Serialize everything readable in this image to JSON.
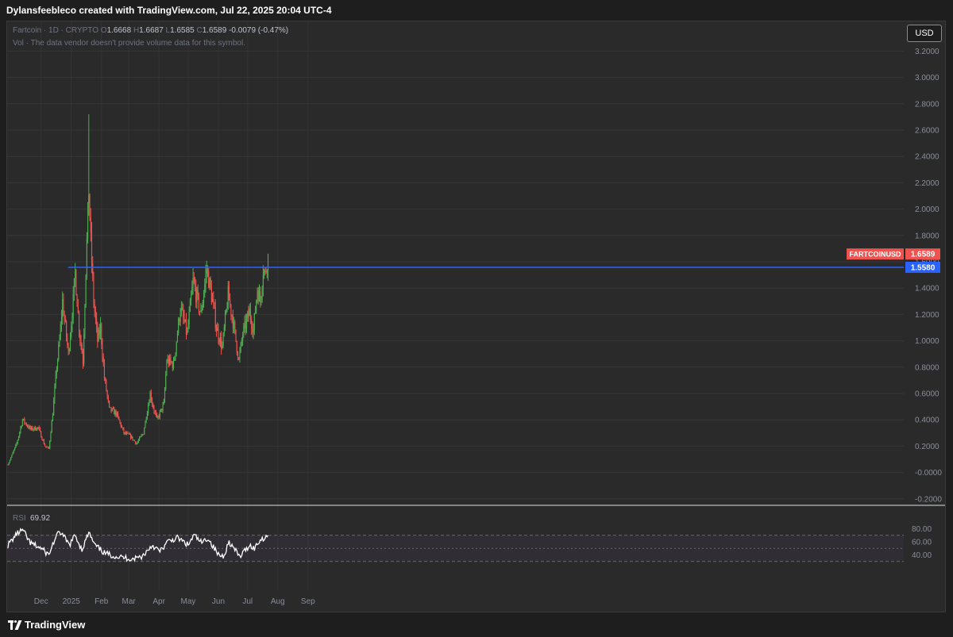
{
  "header": {
    "attribution": "Dylansfeebleco created with TradingView.com, Jul 22, 2025 20:04 UTC-4"
  },
  "legend": {
    "symbol": "Fartcoin · 1D · CRYPTO",
    "open_label": "O",
    "open": "1.6668",
    "high_label": "H",
    "high": "1.6687",
    "low_label": "L",
    "low": "1.6585",
    "close_label": "C",
    "close": "1.6589",
    "change": "-0.0079 (-0.47%)",
    "volume_note": "Vol · The data vendor doesn't provide volume data for this symbol."
  },
  "currency_button": "USD",
  "footer": {
    "brand": "TradingView"
  },
  "colors": {
    "up": "#26a69a",
    "up_bright": "#4caf50",
    "down": "#ef5350",
    "level_line": "#2962ff",
    "rsi_line": "#ffffff"
  },
  "chart_data": [
    {
      "type": "candlestick",
      "symbol_tag": "FARTCOINUSD",
      "last_price": "1.6589",
      "level_price": "1.5580",
      "horizontal_level": 1.558,
      "ylim": [
        -0.22,
        3.3
      ],
      "y_ticks": [
        "3.2000",
        "3.0000",
        "2.8000",
        "2.6000",
        "2.4000",
        "2.2000",
        "2.0000",
        "1.8000",
        "1.6000",
        "1.4000",
        "1.2000",
        "1.0000",
        "0.8000",
        "0.6000",
        "0.4000",
        "0.2000",
        "-0.0000",
        "-0.2000"
      ],
      "x_ticks": [
        "Dec",
        "2025",
        "Feb",
        "Mar",
        "Apr",
        "May",
        "Jun",
        "Jul",
        "Aug",
        "Sep"
      ],
      "anchors": [
        [
          "2024-10-28",
          0.06
        ],
        [
          "2024-11-06",
          0.22
        ],
        [
          "2024-11-12",
          0.4
        ],
        [
          "2024-11-20",
          0.33
        ],
        [
          "2024-11-28",
          0.34
        ],
        [
          "2024-12-05",
          0.2
        ],
        [
          "2024-12-09",
          0.18
        ],
        [
          "2024-12-13",
          0.45
        ],
        [
          "2024-12-17",
          0.8
        ],
        [
          "2024-12-20",
          1.0
        ],
        [
          "2024-12-23",
          1.3
        ],
        [
          "2024-12-26",
          1.1
        ],
        [
          "2024-12-29",
          0.9
        ],
        [
          "2025-01-03",
          1.3
        ],
        [
          "2025-01-05",
          1.52
        ],
        [
          "2025-01-09",
          1.1
        ],
        [
          "2025-01-13",
          0.85
        ],
        [
          "2025-01-16",
          1.55
        ],
        [
          "2025-01-19",
          2.15
        ],
        [
          "2025-01-21",
          1.75
        ],
        [
          "2025-01-24",
          1.3
        ],
        [
          "2025-01-28",
          1.0
        ],
        [
          "2025-01-31",
          1.1
        ],
        [
          "2025-02-04",
          0.72
        ],
        [
          "2025-02-09",
          0.48
        ],
        [
          "2025-02-16",
          0.45
        ],
        [
          "2025-02-24",
          0.3
        ],
        [
          "2025-03-02",
          0.28
        ],
        [
          "2025-03-09",
          0.22
        ],
        [
          "2025-03-16",
          0.3
        ],
        [
          "2025-03-23",
          0.6
        ],
        [
          "2025-03-26",
          0.5
        ],
        [
          "2025-03-30",
          0.4
        ],
        [
          "2025-04-06",
          0.52
        ],
        [
          "2025-04-09",
          0.85
        ],
        [
          "2025-04-16",
          0.82
        ],
        [
          "2025-04-23",
          1.25
        ],
        [
          "2025-04-30",
          1.05
        ],
        [
          "2025-05-06",
          1.45
        ],
        [
          "2025-05-14",
          1.2
        ],
        [
          "2025-05-20",
          1.55
        ],
        [
          "2025-05-26",
          1.3
        ],
        [
          "2025-05-30",
          1.1
        ],
        [
          "2025-06-05",
          0.95
        ],
        [
          "2025-06-11",
          1.35
        ],
        [
          "2025-06-16",
          1.15
        ],
        [
          "2025-06-22",
          0.85
        ],
        [
          "2025-06-26",
          1.05
        ],
        [
          "2025-07-03",
          1.22
        ],
        [
          "2025-07-07",
          1.08
        ],
        [
          "2025-07-11",
          1.4
        ],
        [
          "2025-07-14",
          1.3
        ],
        [
          "2025-07-17",
          1.55
        ],
        [
          "2025-07-19",
          1.5
        ],
        [
          "2025-07-22",
          1.6589
        ]
      ]
    },
    {
      "type": "line",
      "indicator": "RSI",
      "value": "69.92",
      "label": "RSI",
      "levels": [
        70,
        50,
        30
      ],
      "y_ticks": [
        "80.00",
        "60.00",
        "40.00"
      ],
      "ylim": [
        24,
        85
      ],
      "anchors": [
        [
          "2024-10-28",
          55
        ],
        [
          "2024-11-06",
          72
        ],
        [
          "2024-11-12",
          78
        ],
        [
          "2024-11-20",
          58
        ],
        [
          "2024-12-01",
          50
        ],
        [
          "2024-12-09",
          40
        ],
        [
          "2024-12-14",
          60
        ],
        [
          "2024-12-20",
          76
        ],
        [
          "2024-12-26",
          64
        ],
        [
          "2024-12-30",
          55
        ],
        [
          "2025-01-05",
          70
        ],
        [
          "2025-01-12",
          48
        ],
        [
          "2025-01-19",
          74
        ],
        [
          "2025-01-25",
          55
        ],
        [
          "2025-02-05",
          42
        ],
        [
          "2025-02-18",
          37
        ],
        [
          "2025-03-05",
          34
        ],
        [
          "2025-03-15",
          38
        ],
        [
          "2025-03-25",
          55
        ],
        [
          "2025-04-02",
          45
        ],
        [
          "2025-04-10",
          60
        ],
        [
          "2025-04-20",
          66
        ],
        [
          "2025-05-01",
          55
        ],
        [
          "2025-05-07",
          70
        ],
        [
          "2025-05-15",
          58
        ],
        [
          "2025-05-21",
          66
        ],
        [
          "2025-06-01",
          40
        ],
        [
          "2025-06-06",
          38
        ],
        [
          "2025-06-12",
          60
        ],
        [
          "2025-06-23",
          37
        ],
        [
          "2025-07-03",
          55
        ],
        [
          "2025-07-08",
          50
        ],
        [
          "2025-07-14",
          63
        ],
        [
          "2025-07-22",
          69.92
        ]
      ]
    }
  ]
}
